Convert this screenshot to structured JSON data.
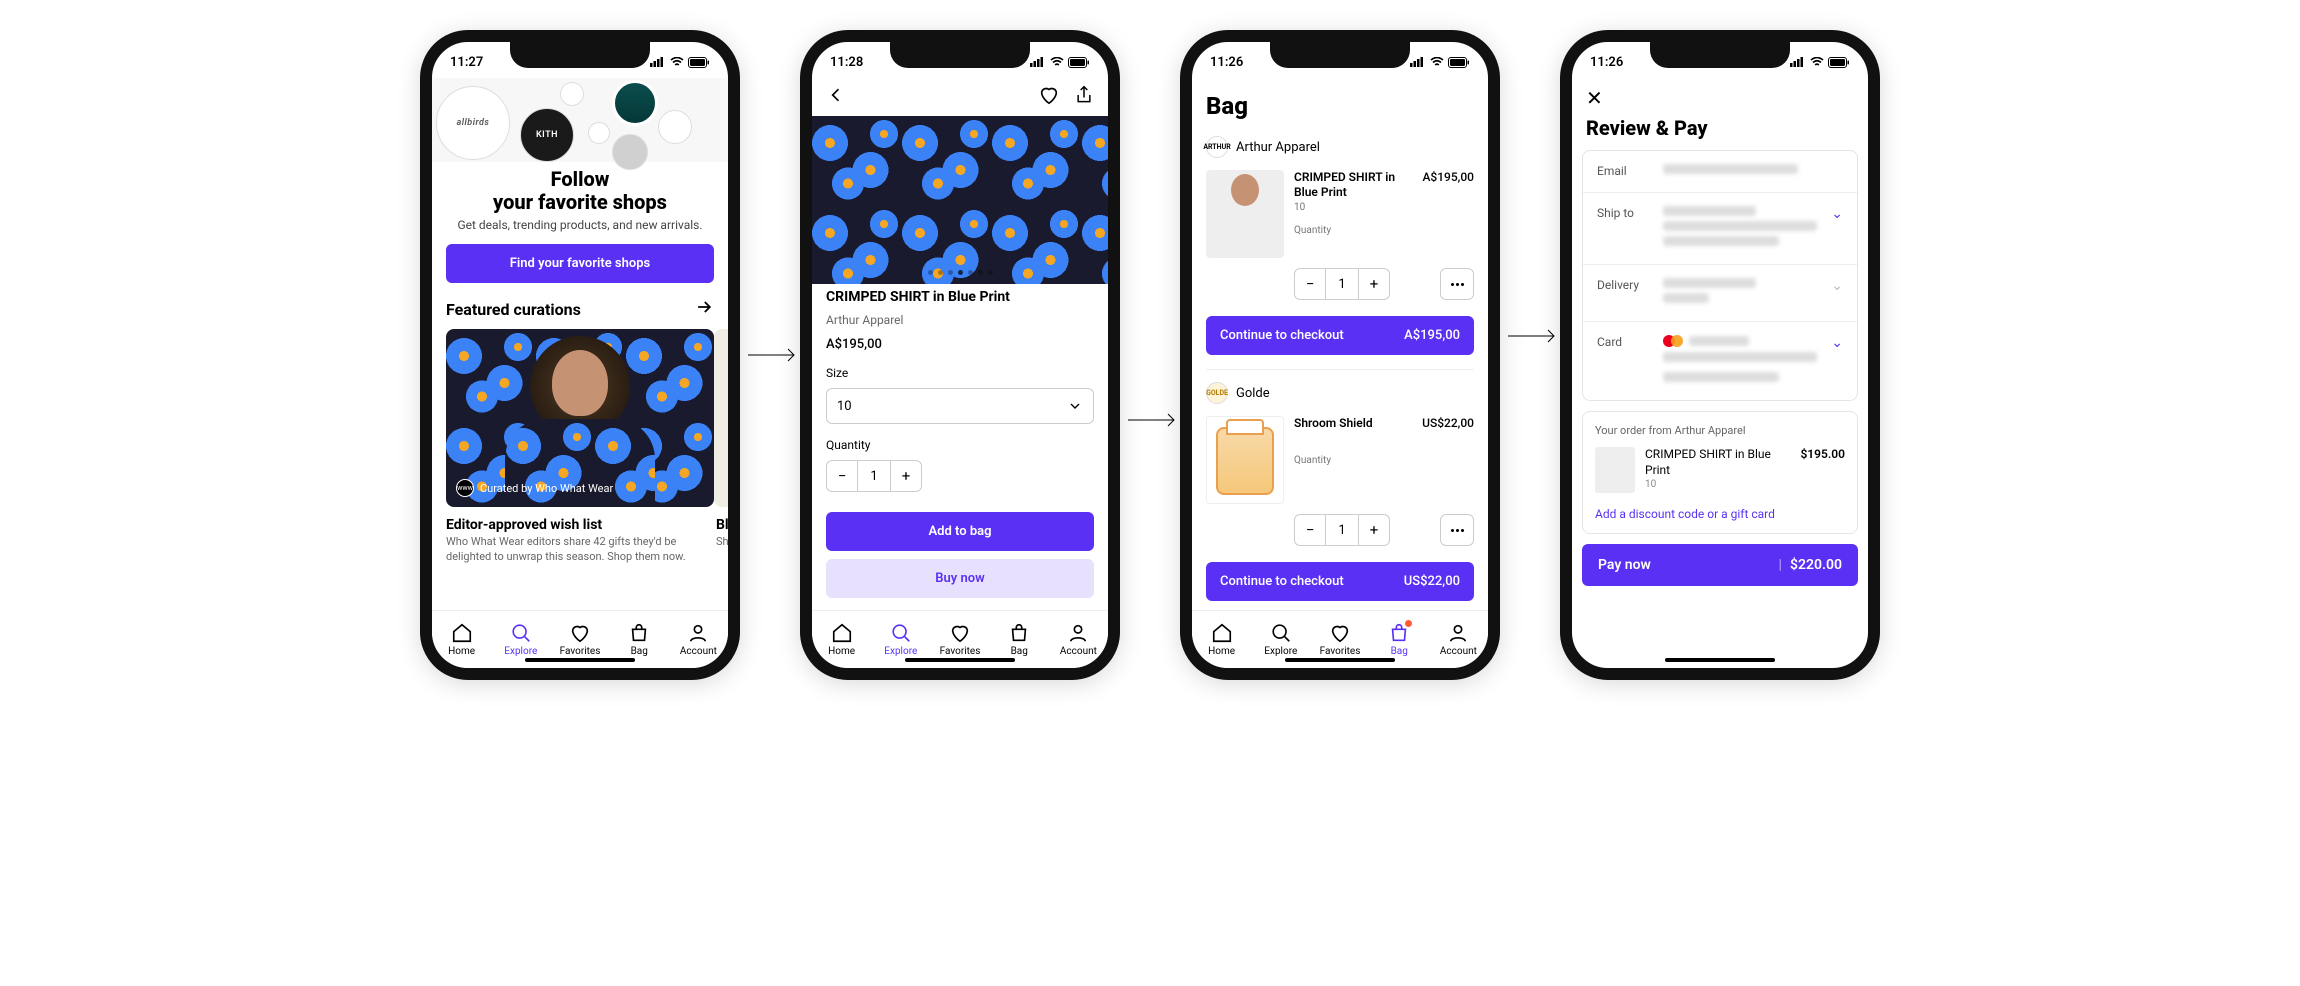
{
  "accent": "#5a31f4",
  "screens": {
    "explore": {
      "time": "11:27",
      "brands": [
        "allbirds",
        "KITH"
      ],
      "headline1": "Follow",
      "headline2": "your favorite shops",
      "subhead": "Get deals, trending products, and new arrivals.",
      "cta": "Find your favorite shops",
      "section_title": "Featured curations",
      "curation": {
        "badge": "Curated by Who What Wear",
        "title": "Editor-approved wish list",
        "desc": "Who What Wear editors share 42 gifts they'd be delighted to unwrap this season. Shop them now.",
        "peek_title": "Bl",
        "peek_desc": "Sh"
      },
      "tabs": [
        "Home",
        "Explore",
        "Favorites",
        "Bag",
        "Account"
      ],
      "active_tab": "Explore"
    },
    "pdp": {
      "time": "11:28",
      "title": "CRIMPED SHIRT in Blue Print",
      "brand": "Arthur Apparel",
      "price": "A$195,00",
      "size_label": "Size",
      "size_value": "10",
      "qty_label": "Quantity",
      "qty_value": "1",
      "add_to_bag": "Add to bag",
      "buy_now": "Buy now",
      "tabs": [
        "Home",
        "Explore",
        "Favorites",
        "Bag",
        "Account"
      ],
      "active_tab": "Explore"
    },
    "bag": {
      "time": "11:26",
      "title": "Bag",
      "merchants": [
        {
          "name": "Arthur Apparel",
          "logo": "ARTHUR",
          "item": {
            "title": "CRIMPED SHIRT in Blue Print",
            "variant": "10",
            "price": "A$195,00",
            "qty_label": "Quantity",
            "qty": "1"
          },
          "checkout_label": "Continue to checkout",
          "checkout_total": "A$195,00"
        },
        {
          "name": "Golde",
          "logo": "GOLDE",
          "item": {
            "title": "Shroom Shield",
            "variant": "",
            "price": "US$22,00",
            "qty_label": "Quantity",
            "qty": "1"
          },
          "checkout_label": "Continue to checkout",
          "checkout_total": "US$22,00"
        }
      ],
      "tabs": [
        "Home",
        "Explore",
        "Favorites",
        "Bag",
        "Account"
      ],
      "active_tab": "Bag"
    },
    "review": {
      "time": "11:26",
      "title": "Review & Pay",
      "rows": {
        "email": "Email",
        "ship_to": "Ship to",
        "delivery": "Delivery",
        "card": "Card"
      },
      "order_from": "Your order from Arthur Apparel",
      "item_title": "CRIMPED SHIRT in Blue Print",
      "item_variant": "10",
      "item_price": "$195.00",
      "discount_link": "Add a discount code or a gift card",
      "pay_label": "Pay now",
      "pay_total": "$220.00"
    }
  }
}
